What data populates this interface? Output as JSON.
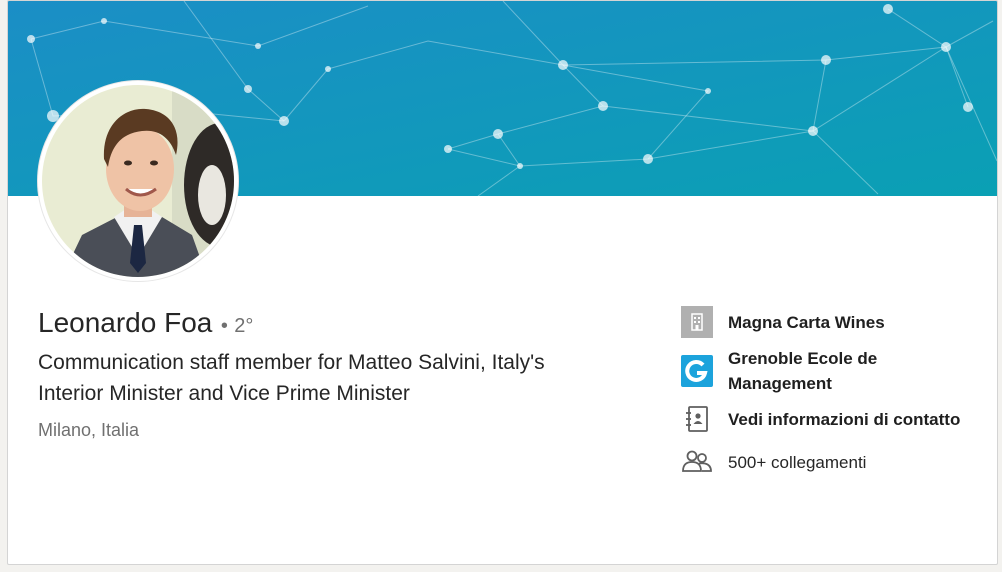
{
  "profile": {
    "name": "Leonardo Foa",
    "degree_separator": "•",
    "degree": "2°",
    "headline_line1": "Communication staff member for Matteo Salvini, Italy's",
    "headline_line2": "Interior Minister and Vice Prime Minister",
    "location": "Milano, Italia"
  },
  "sidebar": {
    "company": {
      "label": "Magna Carta Wines",
      "icon": "building-icon"
    },
    "school": {
      "label": "Grenoble Ecole de Management",
      "icon": "school-logo-icon"
    },
    "contact": {
      "label": "Vedi informazioni di contatto",
      "icon": "contact-book-icon"
    },
    "connections": {
      "label": "500+ collegamenti",
      "icon": "people-icon"
    }
  },
  "colors": {
    "banner_start": "#0f8fc1",
    "banner_end": "#0aa2b3",
    "school_logo": "#1ca3dc",
    "company_logo": "#b0b0b0"
  }
}
